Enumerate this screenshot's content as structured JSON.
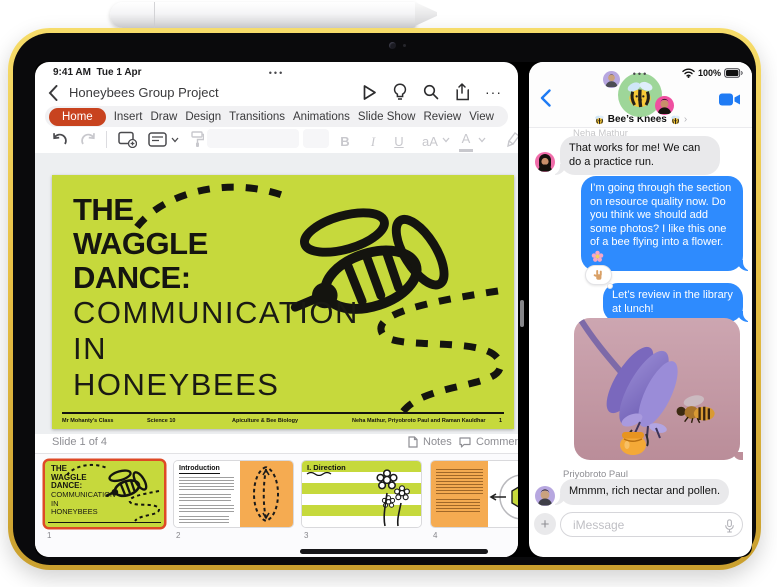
{
  "colors": {
    "frame_yellow": "#e8c045",
    "ppt_accent": "#c8431f",
    "slide_green": "#c6d93c",
    "thumb_orange": "#f5ab51",
    "selection_red": "#de4a26",
    "imessage_blue": "#2e8bfe",
    "bubble_gray": "#e9e9eb"
  },
  "left_app": {
    "status": {
      "time": "9:41 AM",
      "date": "Tue 1 Apr",
      "multitask_dots": "•••"
    },
    "nav": {
      "title": "Honeybees Group Project",
      "more_glyph": "···"
    },
    "ribbon": {
      "selected": "Home",
      "tabs": [
        "Home",
        "Insert",
        "Draw",
        "Design",
        "Transitions",
        "Animations",
        "Slide Show",
        "Review",
        "View"
      ]
    },
    "toolbar": {
      "bold": "B",
      "italic": "I",
      "underline": "U",
      "text_size": "aA",
      "font_color": "A"
    },
    "slide": {
      "title_bold_lines": [
        "THE",
        "WAGGLE",
        "DANCE:"
      ],
      "title_light_lines": [
        "COMMUNICATION",
        "IN",
        "HONEYBEES"
      ],
      "footer": {
        "teacher": "Mr Mohanty’s Class",
        "course": "Science 10",
        "unit": "Apiculture & Bee Biology",
        "authors": "Neha Mathur, Priyobroto Paul and Raman Kauldhar",
        "page": "1"
      }
    },
    "status_row": {
      "slide_label": "Slide 1 of 4",
      "notes": "Notes",
      "comments": "Comments"
    },
    "thumbnails": [
      {
        "number": "1"
      },
      {
        "number": "2",
        "title": "Introduction"
      },
      {
        "number": "3",
        "title": "I. Direction"
      },
      {
        "number": "4"
      }
    ]
  },
  "right_app": {
    "status": {
      "battery": "100%",
      "multitask_dots": "•••"
    },
    "header": {
      "title": "Bee’s Knees",
      "chevron": "›"
    },
    "conversation": {
      "sender1": "Neha Mathur",
      "msg1": "That works for me! We can do a practice run.",
      "msg2": "I’m going through the section on resource quality now. Do you think we should add some photos? I like this one of a bee flying into a flower.",
      "msg3": "Let’s review in the library at lunch!",
      "sender2": "Priyobroto Paul",
      "msg4": "Mmmm, rich nectar and pollen."
    },
    "composer": {
      "placeholder": "iMessage",
      "plus": "+"
    }
  }
}
